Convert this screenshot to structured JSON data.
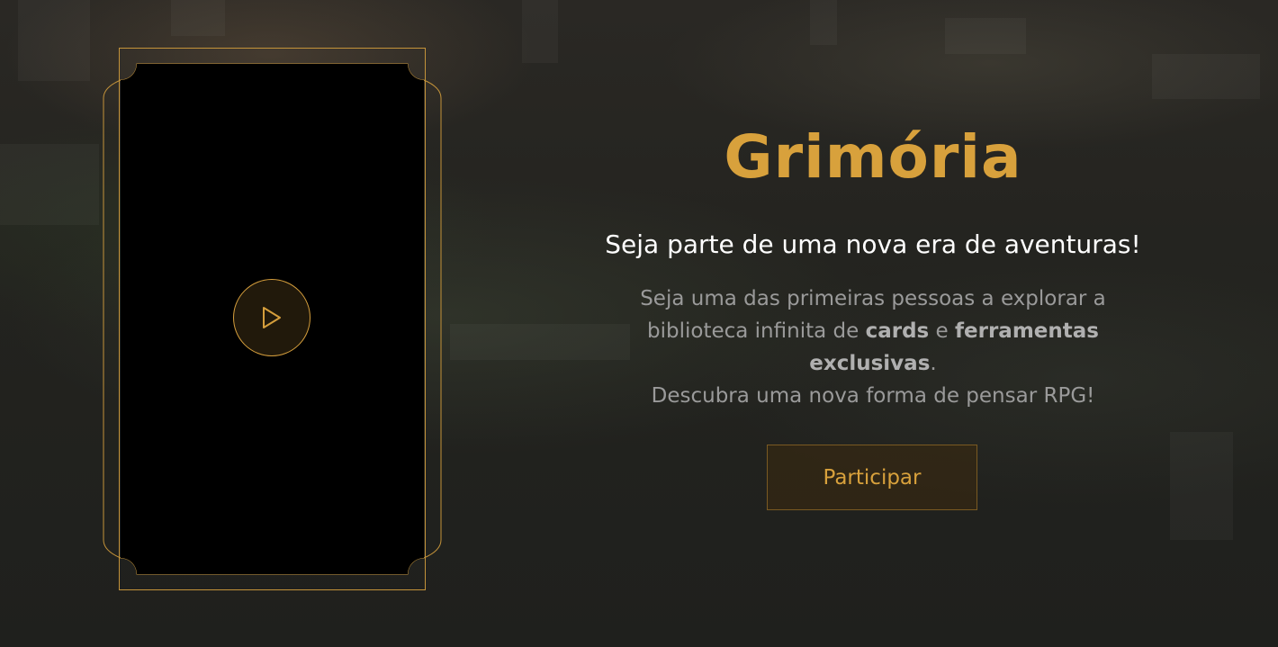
{
  "hero": {
    "title": "Grimória",
    "subtitle": "Seja parte de uma nova era de aventuras!",
    "description": {
      "line1": "Seja uma das primeiras pessoas a explorar a",
      "line2_pre": "biblioteca infinita de ",
      "bold1": "cards",
      "line2_mid": " e ",
      "bold2": "ferramentas",
      "bold2b": "exclusivas",
      "line3_post": ".",
      "line4": "Descubra uma nova forma de pensar RPG!"
    },
    "cta_label": "Participar"
  },
  "video": {
    "play_icon": "play-icon"
  },
  "colors": {
    "accent": "#d8a13c",
    "background": "#1e1e1e",
    "text_muted": "#9a9a9a",
    "text_primary": "#ffffff"
  }
}
